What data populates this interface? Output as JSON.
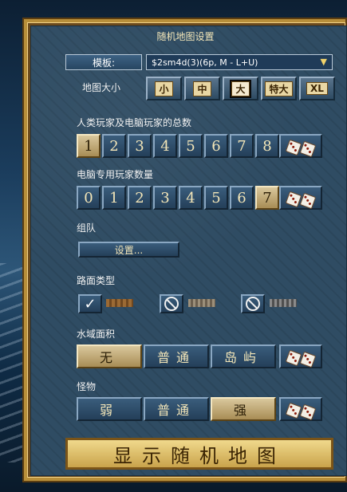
{
  "title": "随机地图设置",
  "template": {
    "label": "模板:",
    "value": "$2sm4d(3)(6p, M - L+U)"
  },
  "map_size": {
    "label": "地图大小",
    "options": [
      "小",
      "中",
      "大",
      "特大",
      "XL"
    ],
    "selected": "大"
  },
  "human_computer": {
    "label": "人类玩家及电脑玩家的总数",
    "options": [
      "1",
      "2",
      "3",
      "4",
      "5",
      "6",
      "7",
      "8"
    ],
    "selected": "1"
  },
  "computer_only": {
    "label": "电脑专用玩家数量",
    "options": [
      "0",
      "1",
      "2",
      "3",
      "4",
      "5",
      "6",
      "7"
    ],
    "selected": "7"
  },
  "team": {
    "label": "组队",
    "button": "设置..."
  },
  "road_types": {
    "label": "路面类型",
    "options": [
      "dirt",
      "gravel",
      "cobblestone"
    ],
    "checked": "dirt"
  },
  "water": {
    "label": "水域面积",
    "options": [
      "无",
      "普通",
      "岛屿"
    ],
    "selected": "无"
  },
  "monsters": {
    "label": "怪物",
    "options": [
      "弱",
      "普通",
      "强"
    ],
    "selected": "强"
  },
  "show_map": "显示随机地图",
  "colors": {
    "panel": "#2f4c63",
    "gold": "#b88f3a",
    "selected": "#d9c79c"
  }
}
